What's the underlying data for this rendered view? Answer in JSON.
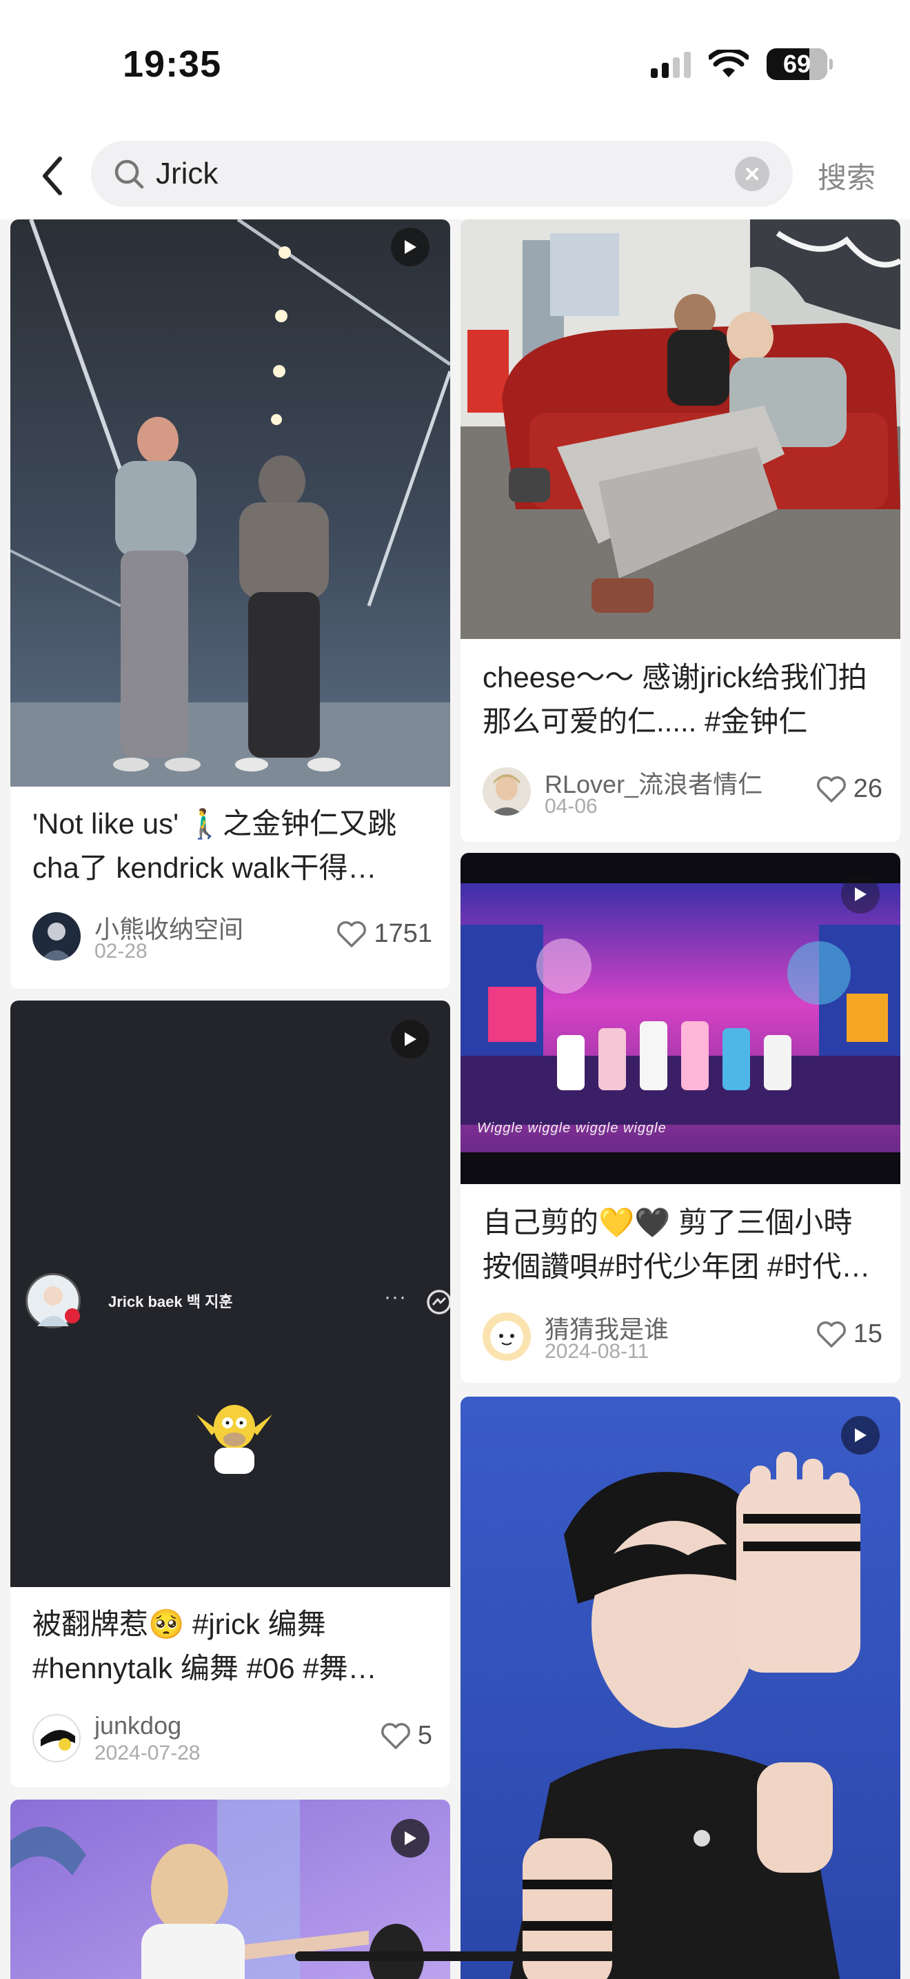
{
  "status": {
    "time": "19:35",
    "battery": "69"
  },
  "search": {
    "query": "Jrick",
    "submit_label": "搜索"
  },
  "cards_left": [
    {
      "title": "'Not like us' 🚶‍♂️之金钟仁又跳cha了 kendrick walk干得…",
      "author": "小熊收纳空间",
      "date": "02-28",
      "likes": "1751",
      "is_video": true
    },
    {
      "title": "被翻牌惹🥺 #jrick 编舞 #hennytalk 编舞 #06 #舞…",
      "author": "junkdog",
      "date": "2024-07-28",
      "likes": "5",
      "is_video": true,
      "inner_post": {
        "username": "Jrick baek 백 지훈"
      }
    },
    {
      "is_video": true
    }
  ],
  "cards_right": [
    {
      "title": "cheese～～ 感谢jrick给我们拍那么可爱的仁..... #金钟仁",
      "author": "RLover_流浪者情仁",
      "date": "04-06",
      "likes": "26"
    },
    {
      "title": "自己剪的💛🖤 剪了三個小時按個讚唄#时代少年团 #时代…",
      "author": "猜猜我是谁",
      "date": "2024-08-11",
      "likes": "15",
      "is_video": true,
      "caption": "Wiggle wiggle wiggle wiggle"
    },
    {
      "is_video": true
    }
  ],
  "colors": {
    "background": "#f4f4f4",
    "card": "#ffffff",
    "muted_text": "#aaaaaa",
    "stage_accent": "#e040c0"
  }
}
